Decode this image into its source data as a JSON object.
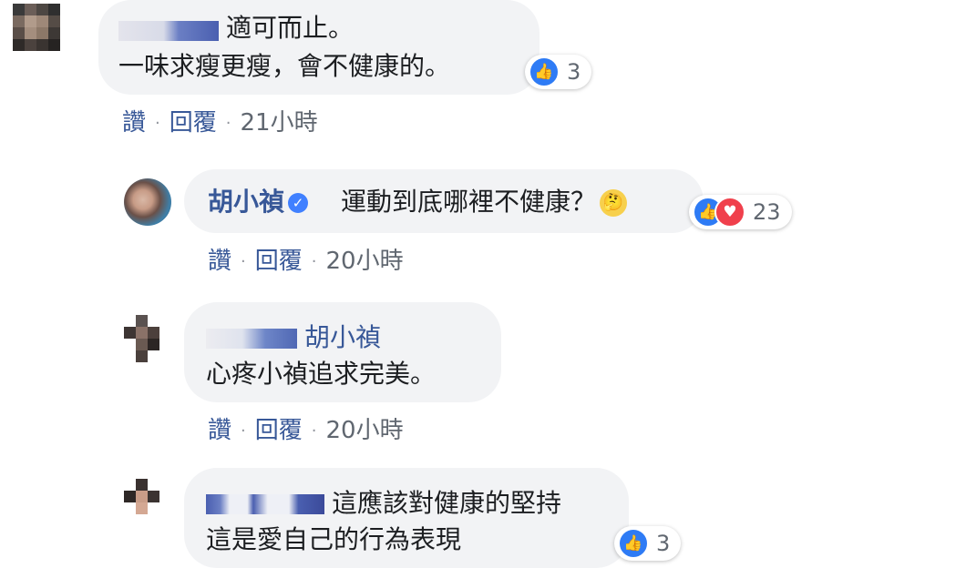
{
  "comments": [
    {
      "author": "",
      "reply_to": "",
      "lines": [
        "適可而止。",
        "一味求瘦更瘦，會不健康的。"
      ],
      "reaction_count": "3",
      "actions": {
        "like": "讚",
        "reply": "回覆",
        "time": "21小時"
      }
    },
    {
      "author": "胡小禎",
      "verified": true,
      "lines": [
        "運動到底哪裡不健康？"
      ],
      "emoji": "thinking-face",
      "reaction_count": "23",
      "actions": {
        "like": "讚",
        "reply": "回覆",
        "time": "20小時"
      }
    },
    {
      "author": "",
      "reply_to": "胡小禎",
      "lines": [
        "心疼小禎追求完美。"
      ],
      "actions": {
        "like": "讚",
        "reply": "回覆",
        "time": "20小時"
      }
    },
    {
      "author": "",
      "lines": [
        "這應該對健康的堅持",
        "這是愛自己的行為表現"
      ],
      "reaction_count": "3"
    }
  ],
  "separator": "·",
  "icons": {
    "like": "like-icon",
    "love": "love-icon",
    "verified": "verified-badge-icon"
  },
  "colors": {
    "link": "#385898",
    "bubble": "#f2f3f5",
    "like": "#2e7bf5",
    "love": "#f0404c"
  }
}
